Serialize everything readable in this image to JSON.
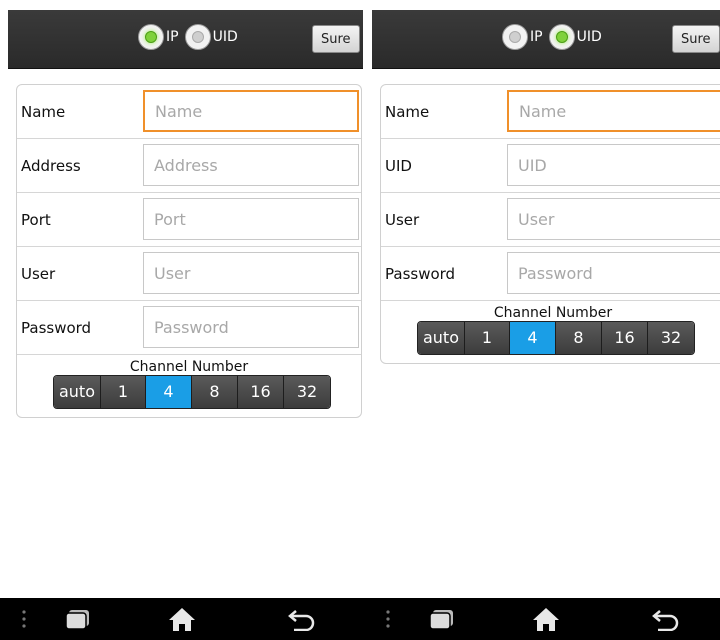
{
  "left": {
    "mode_options": [
      {
        "label": "IP",
        "selected": true
      },
      {
        "label": "UID",
        "selected": false
      }
    ],
    "sure_label": "Sure",
    "fields": [
      {
        "label": "Name",
        "placeholder": "Name",
        "value": "",
        "focused": true
      },
      {
        "label": "Address",
        "placeholder": "Address",
        "value": "",
        "focused": false
      },
      {
        "label": "Port",
        "placeholder": "Port",
        "value": "",
        "focused": false
      },
      {
        "label": "User",
        "placeholder": "User",
        "value": "",
        "focused": false
      },
      {
        "label": "Password",
        "placeholder": "Password",
        "value": "",
        "focused": false
      }
    ],
    "channel": {
      "title": "Channel Number",
      "options": [
        "auto",
        "1",
        "4",
        "8",
        "16",
        "32"
      ],
      "selected": "4"
    }
  },
  "right": {
    "mode_options": [
      {
        "label": "IP",
        "selected": false
      },
      {
        "label": "UID",
        "selected": true
      }
    ],
    "sure_label": "Sure",
    "fields": [
      {
        "label": "Name",
        "placeholder": "Name",
        "value": "",
        "focused": true
      },
      {
        "label": "UID",
        "placeholder": "UID",
        "value": "",
        "focused": false
      },
      {
        "label": "User",
        "placeholder": "User",
        "value": "",
        "focused": false
      },
      {
        "label": "Password",
        "placeholder": "Password",
        "value": "",
        "focused": false
      }
    ],
    "channel": {
      "title": "Channel Number",
      "options": [
        "auto",
        "1",
        "4",
        "8",
        "16",
        "32"
      ],
      "selected": "4"
    }
  },
  "navbar": {
    "icons": [
      "menu-dots-icon",
      "recent-apps-icon",
      "home-icon",
      "back-icon",
      "menu-dots-icon",
      "recent-apps-icon",
      "home-icon",
      "back-icon"
    ]
  },
  "colors": {
    "accent_selected": "#1a9ee6",
    "focus_border": "#f0902a",
    "radio_on": "#7fd13b",
    "topbar": "#333333",
    "navbar": "#000000"
  }
}
